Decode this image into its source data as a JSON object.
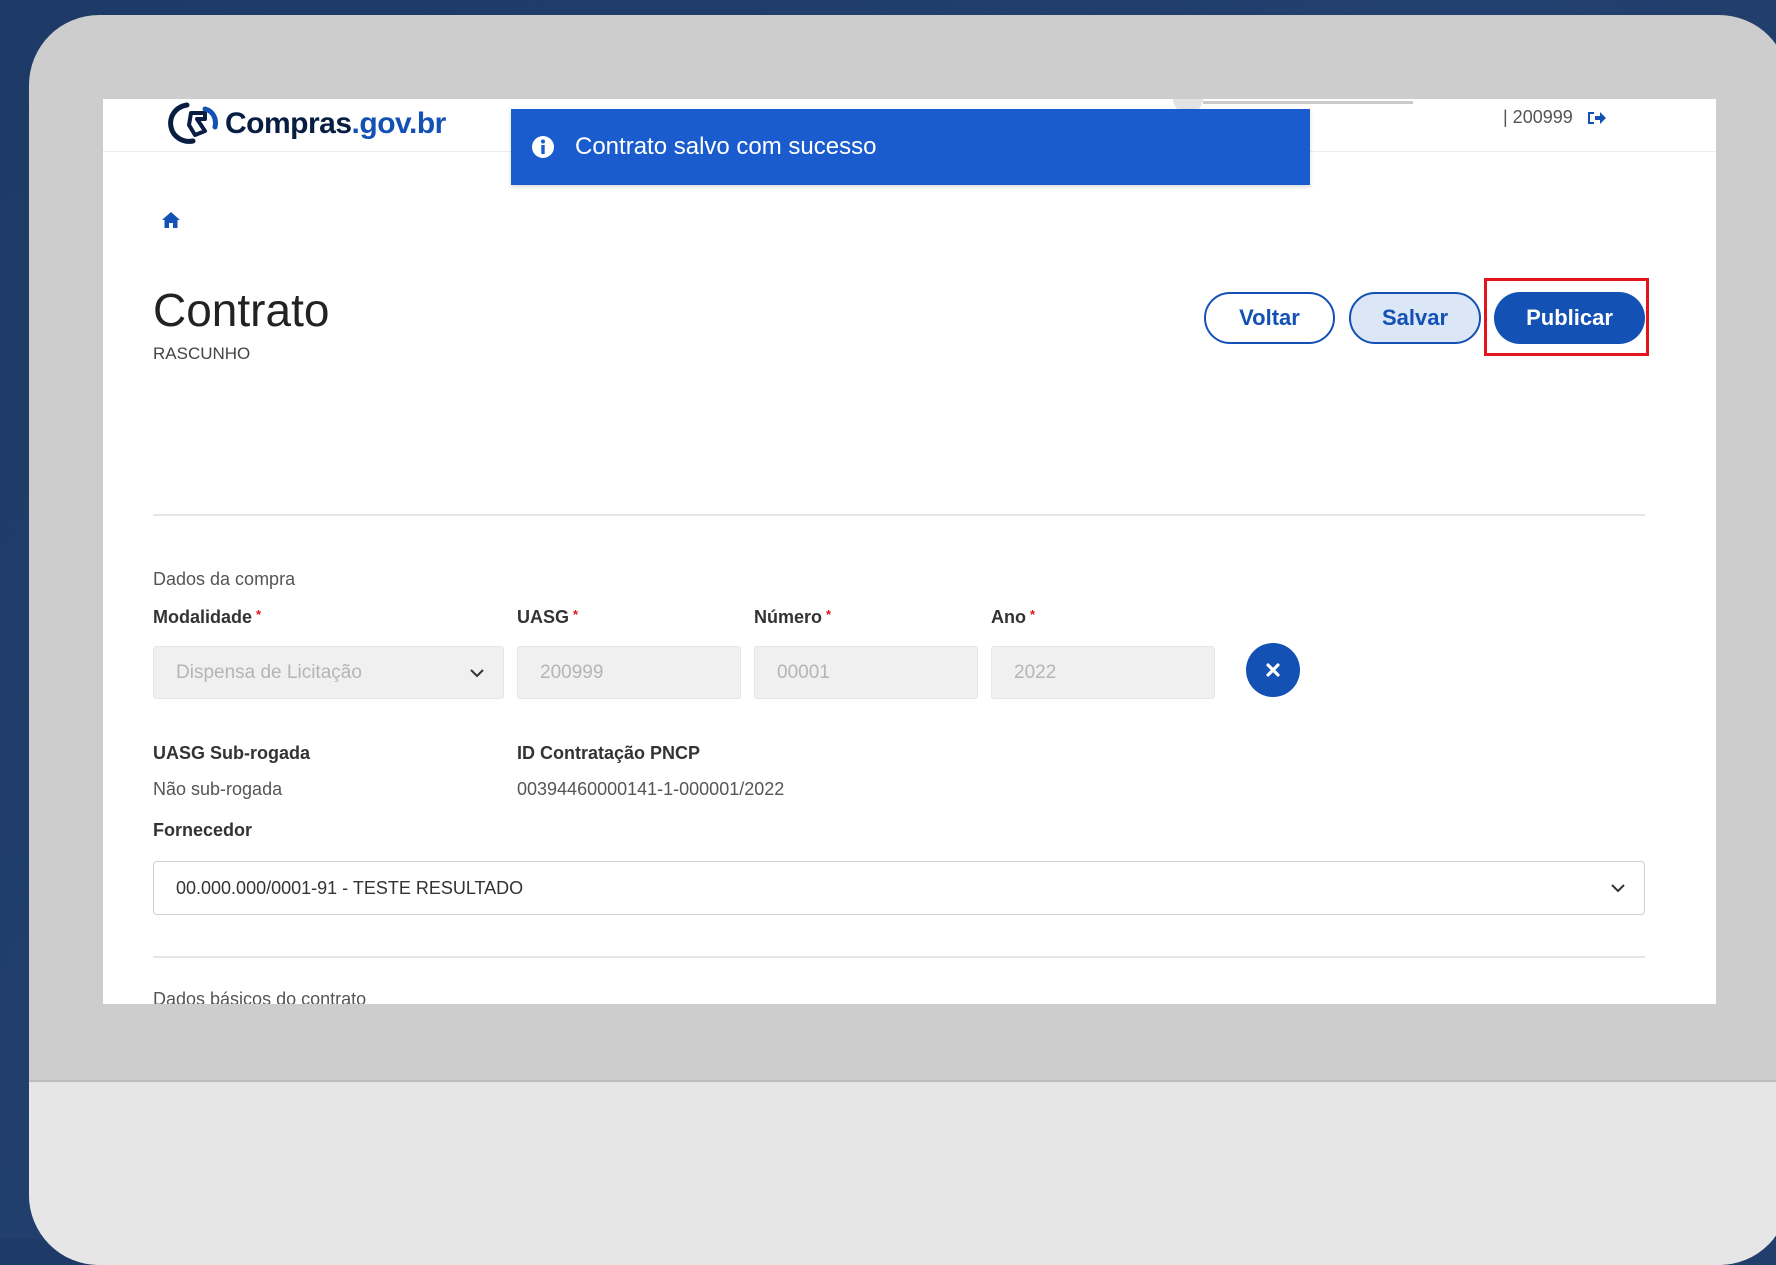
{
  "header": {
    "logo_main": "Compras",
    "logo_domain": ".gov.br",
    "user_code": "| 200999"
  },
  "toast": {
    "message": "Contrato salvo com sucesso"
  },
  "page": {
    "title": "Contrato",
    "status": "RASCUNHO"
  },
  "actions": {
    "voltar": "Voltar",
    "salvar": "Salvar",
    "publicar": "Publicar"
  },
  "compra": {
    "section_label": "Dados da compra",
    "modalidade_label": "Modalidade",
    "modalidade_value": "Dispensa de Licitação",
    "uasg_label": "UASG",
    "uasg_value": "200999",
    "numero_label": "Número",
    "numero_value": "00001",
    "ano_label": "Ano",
    "ano_value": "2022",
    "subrogada_label": "UASG Sub-rogada",
    "subrogada_value": "Não sub-rogada",
    "pncp_label": "ID Contratação PNCP",
    "pncp_value": "00394460000141-1-000001/2022",
    "fornecedor_label": "Fornecedor",
    "fornecedor_value": "00.000.000/0001-91 - TESTE RESULTADO"
  },
  "contrato": {
    "section_label": "Dados básicos do contrato"
  },
  "colors": {
    "primary": "#1351b4",
    "toast": "#1a5ccd",
    "highlight": "#e3141b",
    "background": "#1e3a66"
  },
  "icons": {
    "logo": "gov-logo-icon",
    "logout": "logout-icon",
    "toast": "info-icon",
    "home": "home-icon",
    "clear": "close-icon",
    "dropdown": "chevron-down-icon"
  }
}
